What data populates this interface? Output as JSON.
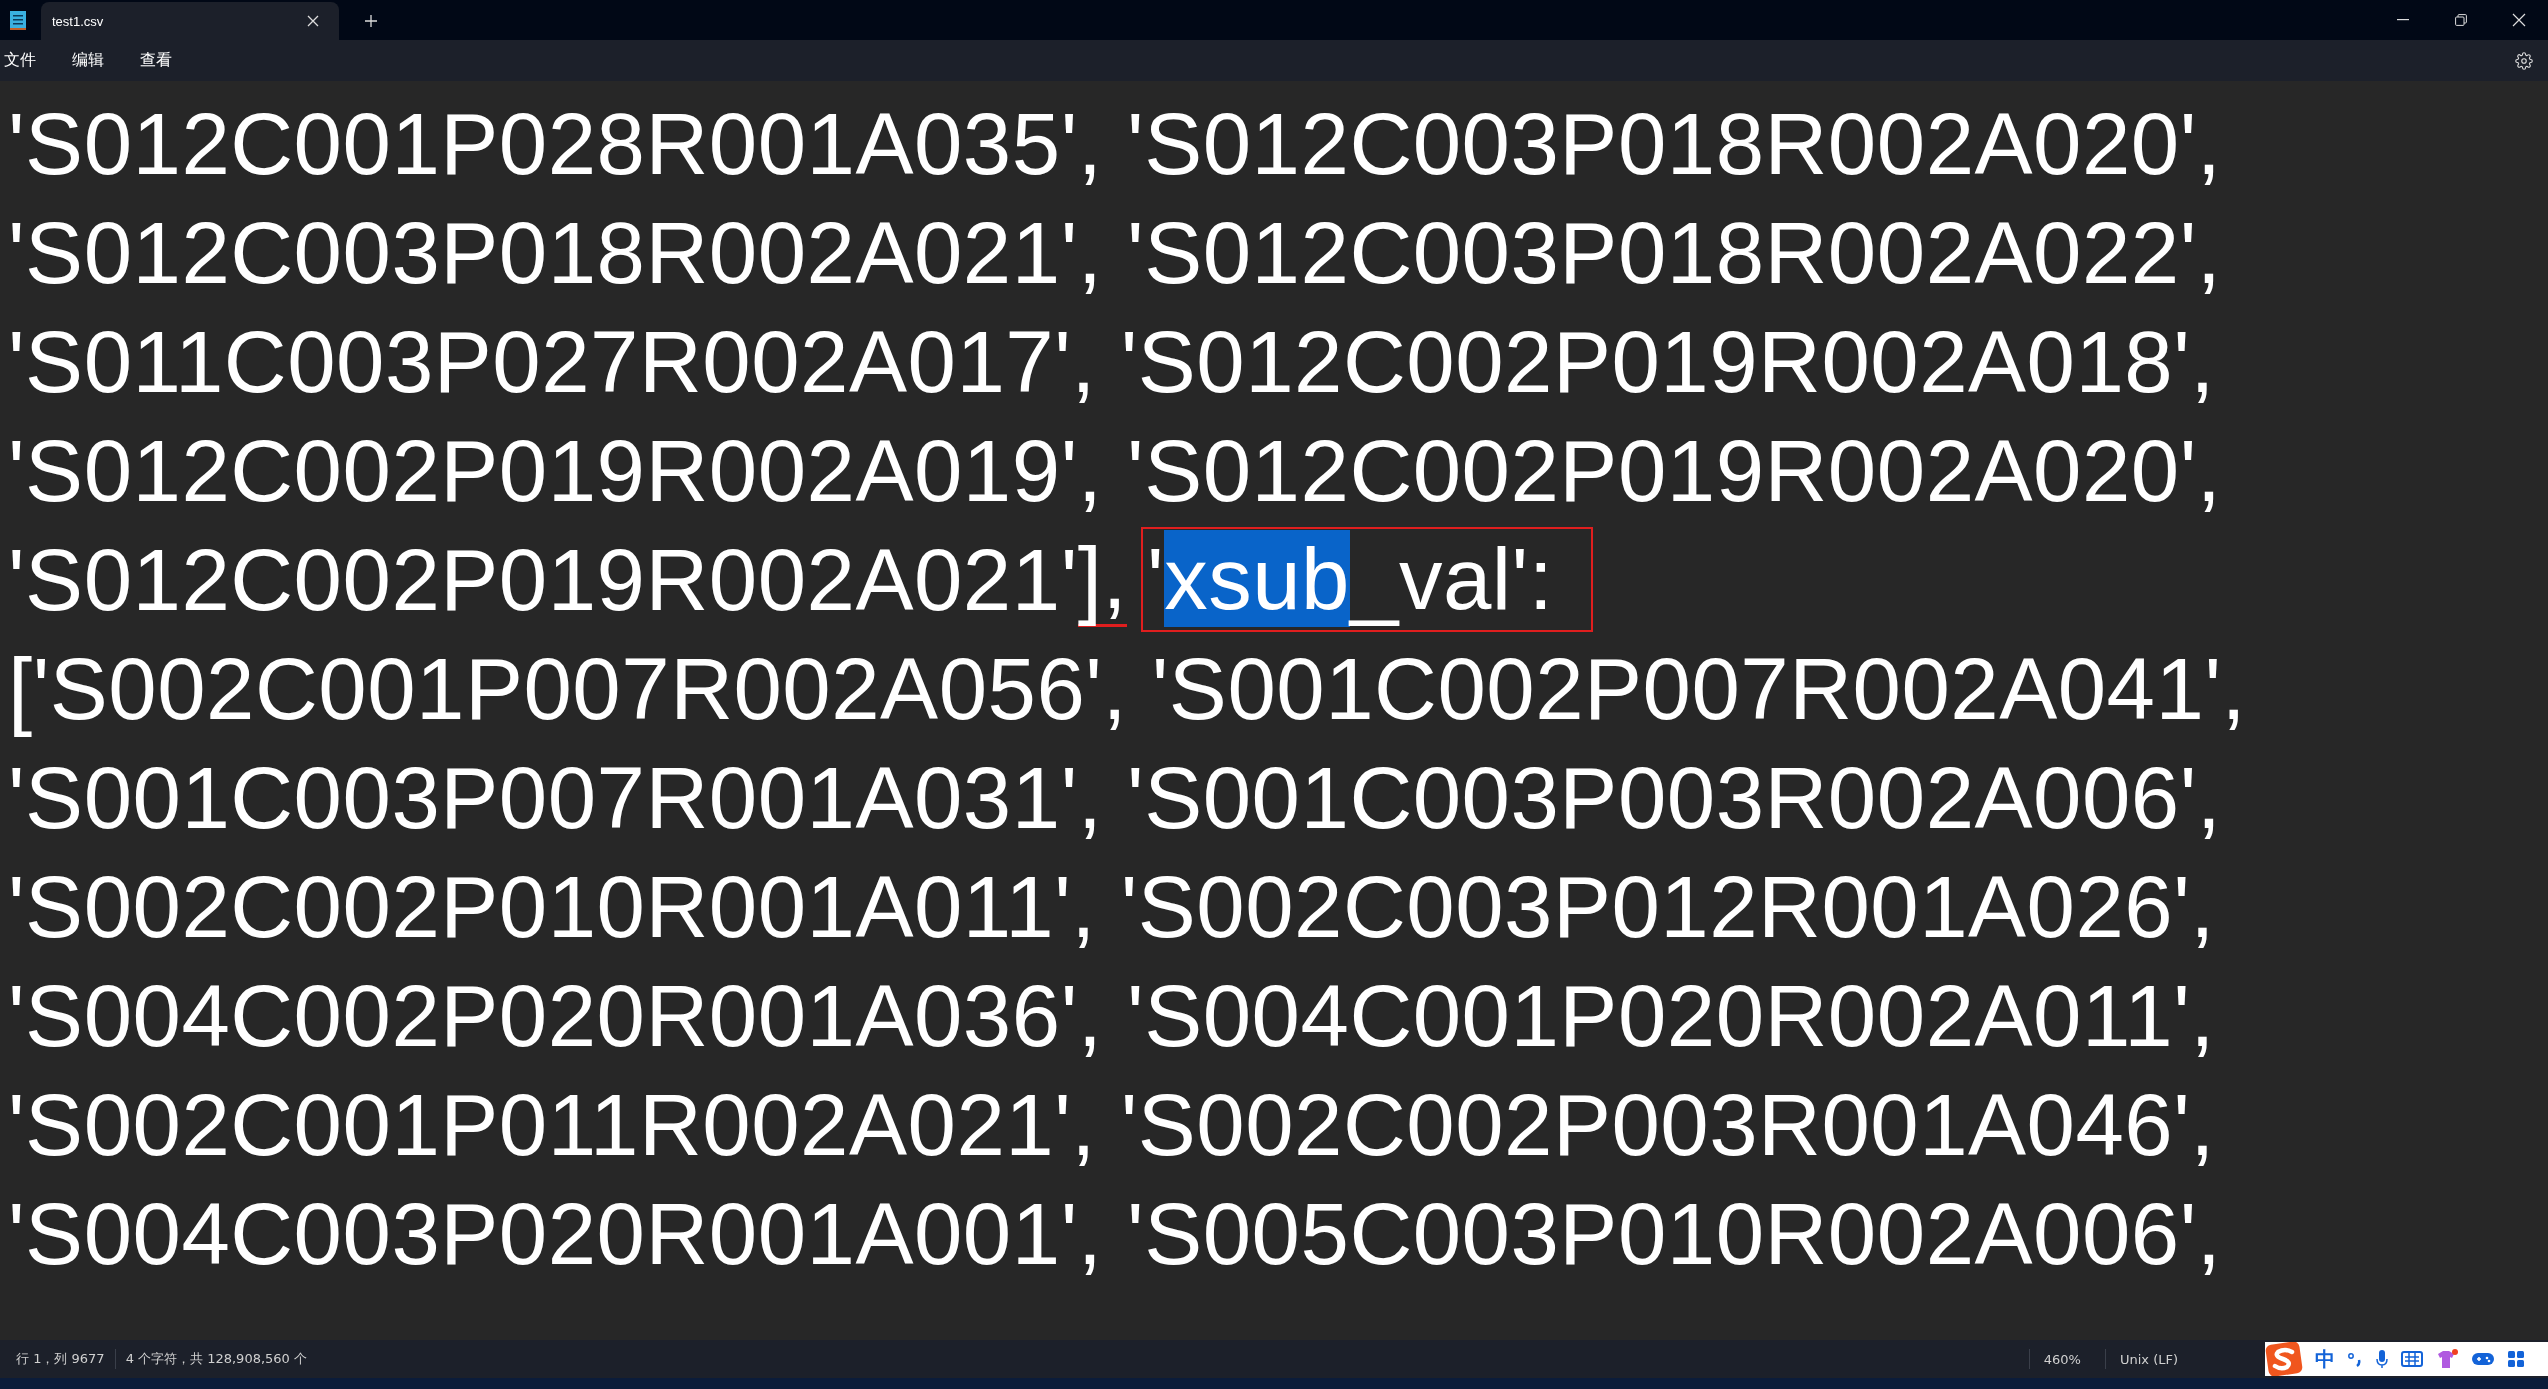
{
  "tab": {
    "title": "test1.csv",
    "selected": true
  },
  "menu": [
    "文件",
    "编辑",
    "查看"
  ],
  "lines": [
    [
      {
        "kind": "plain",
        "text": "'S012C001P028R001A035', 'S012C003P018R002A020',"
      }
    ],
    [
      {
        "kind": "plain",
        "text": "'S012C003P018R002A021', 'S012C003P018R002A022',"
      }
    ],
    [
      {
        "kind": "plain",
        "text": "'S011C003P027R002A017', 'S012C002P019R002A018',"
      }
    ],
    [
      {
        "kind": "plain",
        "text": "'S012C002P019R002A019', 'S012C002P019R002A020',"
      }
    ],
    [
      {
        "kind": "plain",
        "text": "'S012C002P019R002A021'"
      },
      {
        "kind": "underline",
        "text": "],"
      },
      {
        "kind": "box",
        "parts": [
          {
            "text": "'",
            "selected": false
          },
          {
            "text": "xsub",
            "selected": true
          },
          {
            "text": "_val':",
            "selected": false
          }
        ]
      }
    ],
    [
      {
        "kind": "plain",
        "text": "['S002C001P007R002A056', 'S001C002P007R002A041',"
      }
    ],
    [
      {
        "kind": "plain",
        "text": "'S001C003P007R001A031', 'S001C003P003R002A006',"
      }
    ],
    [
      {
        "kind": "plain",
        "text": "'S002C002P010R001A011', 'S002C003P012R001A026',"
      }
    ],
    [
      {
        "kind": "plain",
        "text": "'S004C002P020R001A036', 'S004C001P020R002A011',"
      }
    ],
    [
      {
        "kind": "plain",
        "text": "'S002C001P011R002A021', 'S002C002P003R001A046',"
      }
    ],
    [
      {
        "kind": "plain",
        "text": "'S004C003P020R001A001', 'S005C003P010R002A006',"
      }
    ]
  ],
  "status": {
    "position": "行 1，列 9677",
    "selection": "4 个字符，共 128,908,560 个",
    "zoom": "460%",
    "line_ending": "Unix (LF)"
  },
  "ime": {
    "mode": "中"
  }
}
